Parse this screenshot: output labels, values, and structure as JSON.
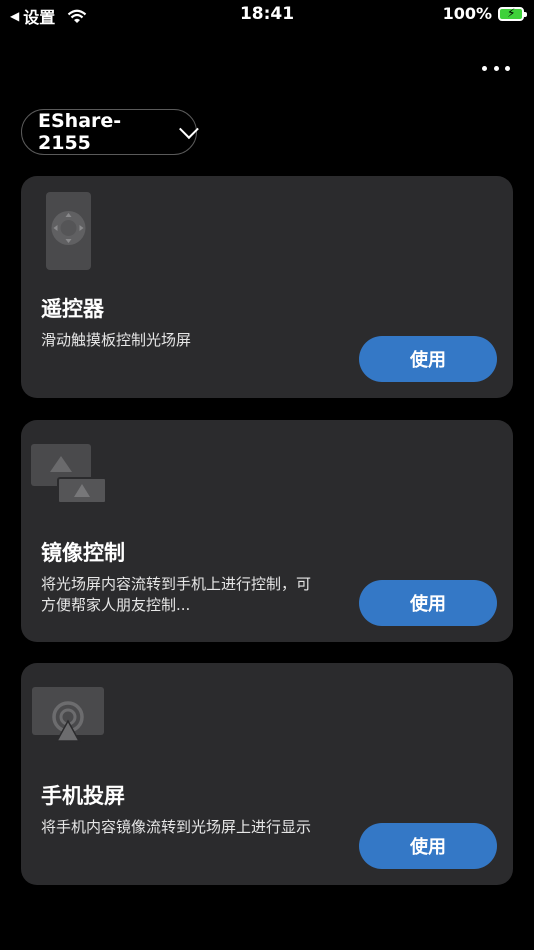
{
  "status_bar": {
    "back_label": "设置",
    "time": "18:41",
    "battery": "100%"
  },
  "device_selector": {
    "name": "EShare-2155"
  },
  "cards": [
    {
      "title": "遥控器",
      "description": "滑动触摸板控制光场屏",
      "button": "使用",
      "icon": "remote-control-icon"
    },
    {
      "title": "镜像控制",
      "description": "将光场屏内容流转到手机上进行控制，可方便帮家人朋友控制...",
      "button": "使用",
      "icon": "mirror-screens-icon"
    },
    {
      "title": "手机投屏",
      "description": "将手机内容镜像流转到光场屏上进行显示",
      "button": "使用",
      "icon": "airplay-icon"
    }
  ]
}
